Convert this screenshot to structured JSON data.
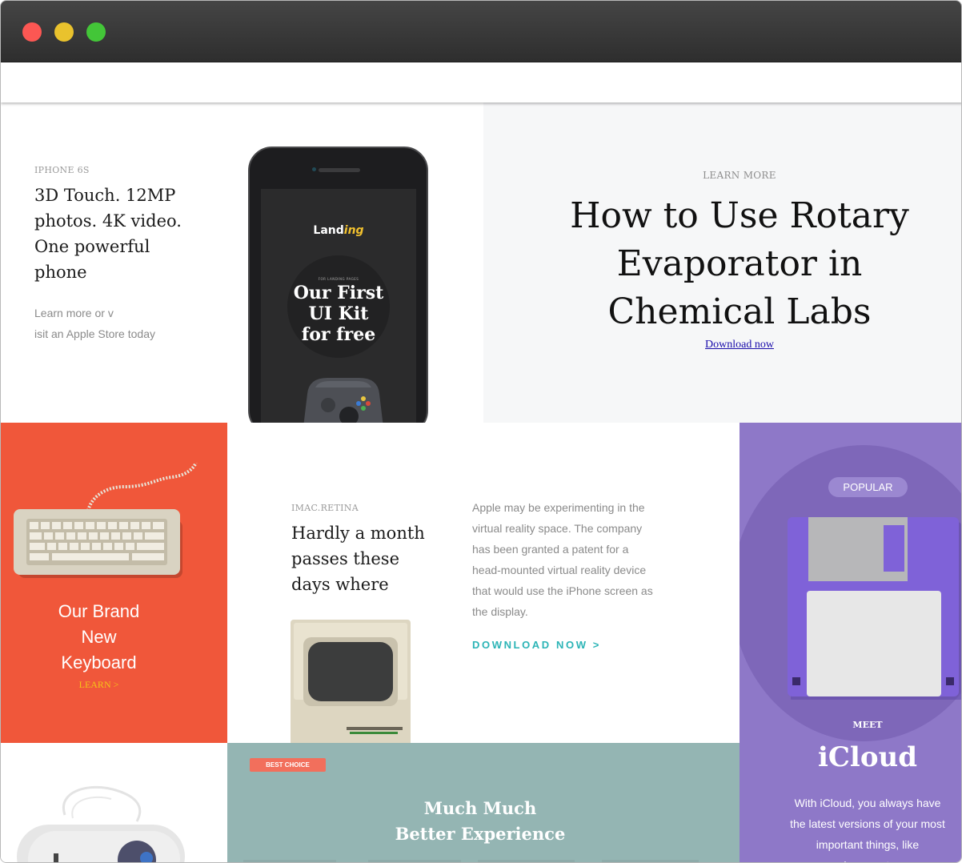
{
  "window": {
    "controls": [
      "close",
      "minimize",
      "maximize"
    ]
  },
  "iphone": {
    "eyebrow": "IPHONE 6S",
    "headline": "3D Touch. 12MP photos. 4K video. One powerful phone",
    "sub_line1": "Learn more or v",
    "sub_line2": "isit an Apple Store today",
    "screen": {
      "brand_main": "Land",
      "brand_accent": "ing",
      "tiny": "FOR LANDING PAGES",
      "kit_line1": "Our First",
      "kit_line2": "UI Kit",
      "kit_line3": "for free"
    }
  },
  "rotary": {
    "eyebrow": "LEARN MORE",
    "title_line1": "How to Use Rotary",
    "title_line2": "Evaporator in",
    "title_line3": "Chemical Labs",
    "link": "Download now"
  },
  "keyboard": {
    "title_line1": "Our Brand",
    "title_line2": "New",
    "title_line3": "Keyboard",
    "learn": "LEARN ˃"
  },
  "imac": {
    "eyebrow": "IMAC.RETINA",
    "headline": "Hardly a month passes these days where",
    "paragraph": "Apple may be experimenting in the virtual reality space. The company has been granted a patent for a head-mounted virtual reality device that would use the iPhone screen as the display.",
    "download": "DOWNLOAD NOW ˃"
  },
  "popular": {
    "pill": " POPULAR",
    "meet": "MEET",
    "title": "iCloud",
    "text": "With iCloud, you always have the latest versions of your most important things, like documents"
  },
  "experience": {
    "badge": "BEST CHOICE",
    "title_line1": "Much Much",
    "title_line2": "Better Experience"
  },
  "colors": {
    "titlebar": "#3a3a3a",
    "coral": "#f0573a",
    "purple": "#8e78c8",
    "teal_bg": "#94b5b3",
    "accent_teal": "#2bb4b6",
    "badge": "#f26f5c",
    "link": "#1a0dab"
  }
}
